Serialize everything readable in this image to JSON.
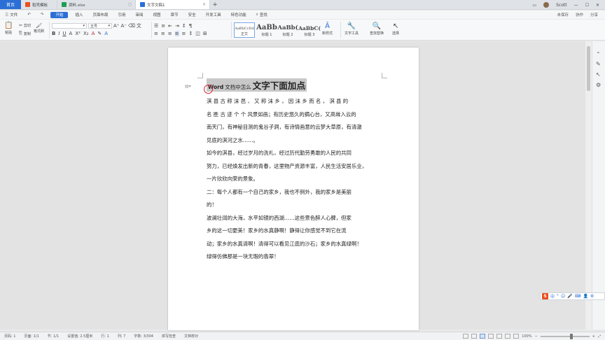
{
  "tabs": {
    "home": "首页",
    "items": [
      {
        "label": "稻壳模板",
        "color": "#e8501d"
      },
      {
        "label": "资料.xlsx",
        "color": "#1f9d55"
      },
      {
        "label": "文字文稿1",
        "color": "#2b6fd6"
      }
    ],
    "add": "+",
    "right": {
      "save_mode": "未保存",
      "collab": "协作",
      "user": "Scott"
    }
  },
  "menu": {
    "file": "三 文件",
    "items": [
      "开始",
      "插入",
      "页面布局",
      "引用",
      "审阅",
      "视图",
      "章节",
      "安全",
      "开发工具",
      "特色功能"
    ],
    "search": "查找",
    "right": [
      "未保存",
      "协作",
      "分享"
    ]
  },
  "ribbon": {
    "clipboard": {
      "paste": "粘贴",
      "cut": "剪切",
      "copy": "复制",
      "format_painter": "格式刷"
    },
    "font": {
      "name": "",
      "size": "五号"
    },
    "styles": [
      {
        "preview": "AaBbCcDd",
        "name": "正文"
      },
      {
        "preview": "AaBb",
        "name": "标题 1"
      },
      {
        "preview": "AaBb(",
        "name": "标题 2"
      },
      {
        "preview": "AaBbC(",
        "name": "标题 3"
      }
    ],
    "new_style": "新样式",
    "text_tools": "文字工具",
    "find_replace": "查找替换",
    "select": "选择"
  },
  "document": {
    "title": {
      "word": "Word",
      "small": "文档中怎么",
      "large": "文字下面加点"
    },
    "lines": [
      "淇 县 古 称 沫 邑 、 又 称 沫 乡 ， 因 沫 乡 而 名 ， 淇 县 的",
      "名 胜 古 迹 个 个 风景如画；有历史悠久的摘心台，又高耸入云的",
      "南天门，有神秘目测的鬼谷子洞，有诗情画意的云梦大草原，有清澈",
      "见底的淇河之水……。",
      "    如今的淇县，经过岁月的洗礼，经过历代勤劳勇敢的人民的共同",
      "努力，已经焕发出新的青春，这里物产资源丰富，人民生活安居乐业，",
      "一片欣欣向荣的景象。",
      "    二：每个人都有一个自己的家乡，我也不例外，我的家乡是美丽",
      "的！",
      "    波澜壮阔的大海，水平如镜的西湖……这些景色醉人心脾，但家",
      "乡的这一切更美！家乡的水真静啊！静得让你感觉不到它在流",
      "动；家乡的水真清啊！清得可以看见江底的沙石；家乡的水真绿啊！",
      "绿得仿佛那是一块无瑕的翡翠！"
    ]
  },
  "ime": {
    "logo": "S",
    "items": [
      "中",
      "°",
      "☺",
      "🎤",
      "⌨",
      "👤",
      "⚙"
    ]
  },
  "status": {
    "page": "页码: 1",
    "pages": "页面: 1/1",
    "section": "节: 1/1",
    "setting": "设置值: 2.5厘米",
    "row": "行: 1",
    "col": "列: 7",
    "words": "字数: 3/304",
    "spell": "拼写检查",
    "proof": "文档校对",
    "zoom": "100%"
  },
  "colors": {
    "accent": "#2b6fd6",
    "highlight": "#c8c8c8",
    "mark_red": "#d22233"
  }
}
